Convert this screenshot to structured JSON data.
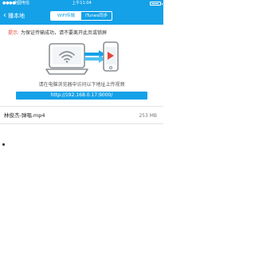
{
  "status": {
    "signal": "●●●●○",
    "carrier": "中国电信",
    "time": "上午11:04"
  },
  "nav": {
    "back_label": "播本地",
    "tabs": [
      {
        "label": "WiFi传输",
        "active": true
      },
      {
        "label": "iTunes同步",
        "active": false
      }
    ]
  },
  "hint": {
    "label": "提示:",
    "text": "为保证传输成功，请不要离开此页或锁屏"
  },
  "instruction": "请在电脑浏览器中访问以下地址上传视频",
  "url": "http://192.168.0.17:9000/",
  "files": [
    {
      "name": "林俊杰-弹唱.mp4",
      "size": "253 MB"
    }
  ],
  "colors": {
    "accent": "#14a1e8",
    "hint_label": "#e2463b"
  }
}
